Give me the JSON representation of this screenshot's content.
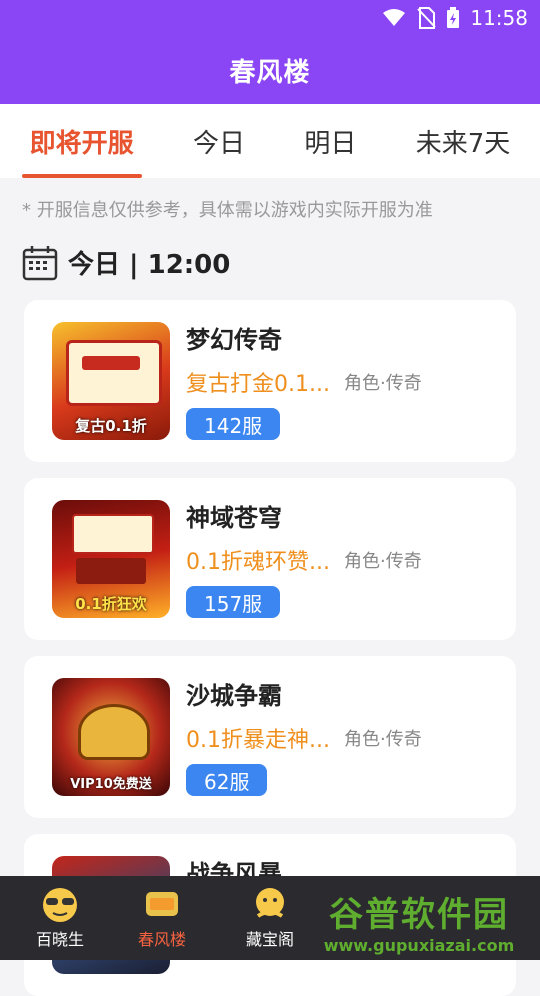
{
  "status_bar": {
    "time": "11:58"
  },
  "app_bar": {
    "title": "春风楼"
  },
  "tabs": [
    {
      "label": "即将开服",
      "active": true
    },
    {
      "label": "今日",
      "active": false
    },
    {
      "label": "明日",
      "active": false
    },
    {
      "label": "未来7天",
      "active": false
    }
  ],
  "notice": "* 开服信息仅供参考，具体需以游戏内实际开服为准",
  "section": {
    "header": "今日 | 12:00"
  },
  "games": [
    {
      "name": "梦幻传奇",
      "desc": "复古打金0.1...",
      "tags": "角色·传奇",
      "server": "142服",
      "thumb_caption": "复古0.1折"
    },
    {
      "name": "神域苍穹",
      "desc": "0.1折魂环赞...",
      "tags": "角色·传奇",
      "server": "157服",
      "thumb_caption": "0.1折狂欢"
    },
    {
      "name": "沙城争霸",
      "desc": "0.1折暴走神...",
      "tags": "角色·传奇",
      "server": "62服",
      "thumb_caption": "VIP10免费送"
    },
    {
      "name": "战争风暴",
      "desc": "",
      "tags": "",
      "server": "",
      "thumb_caption": ""
    }
  ],
  "bottom_nav": [
    {
      "label": "百晓生",
      "icon": "face-icon",
      "active": false
    },
    {
      "label": "春风楼",
      "icon": "new-server-icon",
      "active": true
    },
    {
      "label": "藏宝阁",
      "icon": "treasure-icon",
      "active": false
    }
  ],
  "watermark": {
    "title": "谷普软件园",
    "url": "www.gupuxiazai.com"
  },
  "colors": {
    "primary": "#8a45f5",
    "accent": "#e7542f",
    "badge": "#3b86f0",
    "desc": "#ef8f1e"
  }
}
